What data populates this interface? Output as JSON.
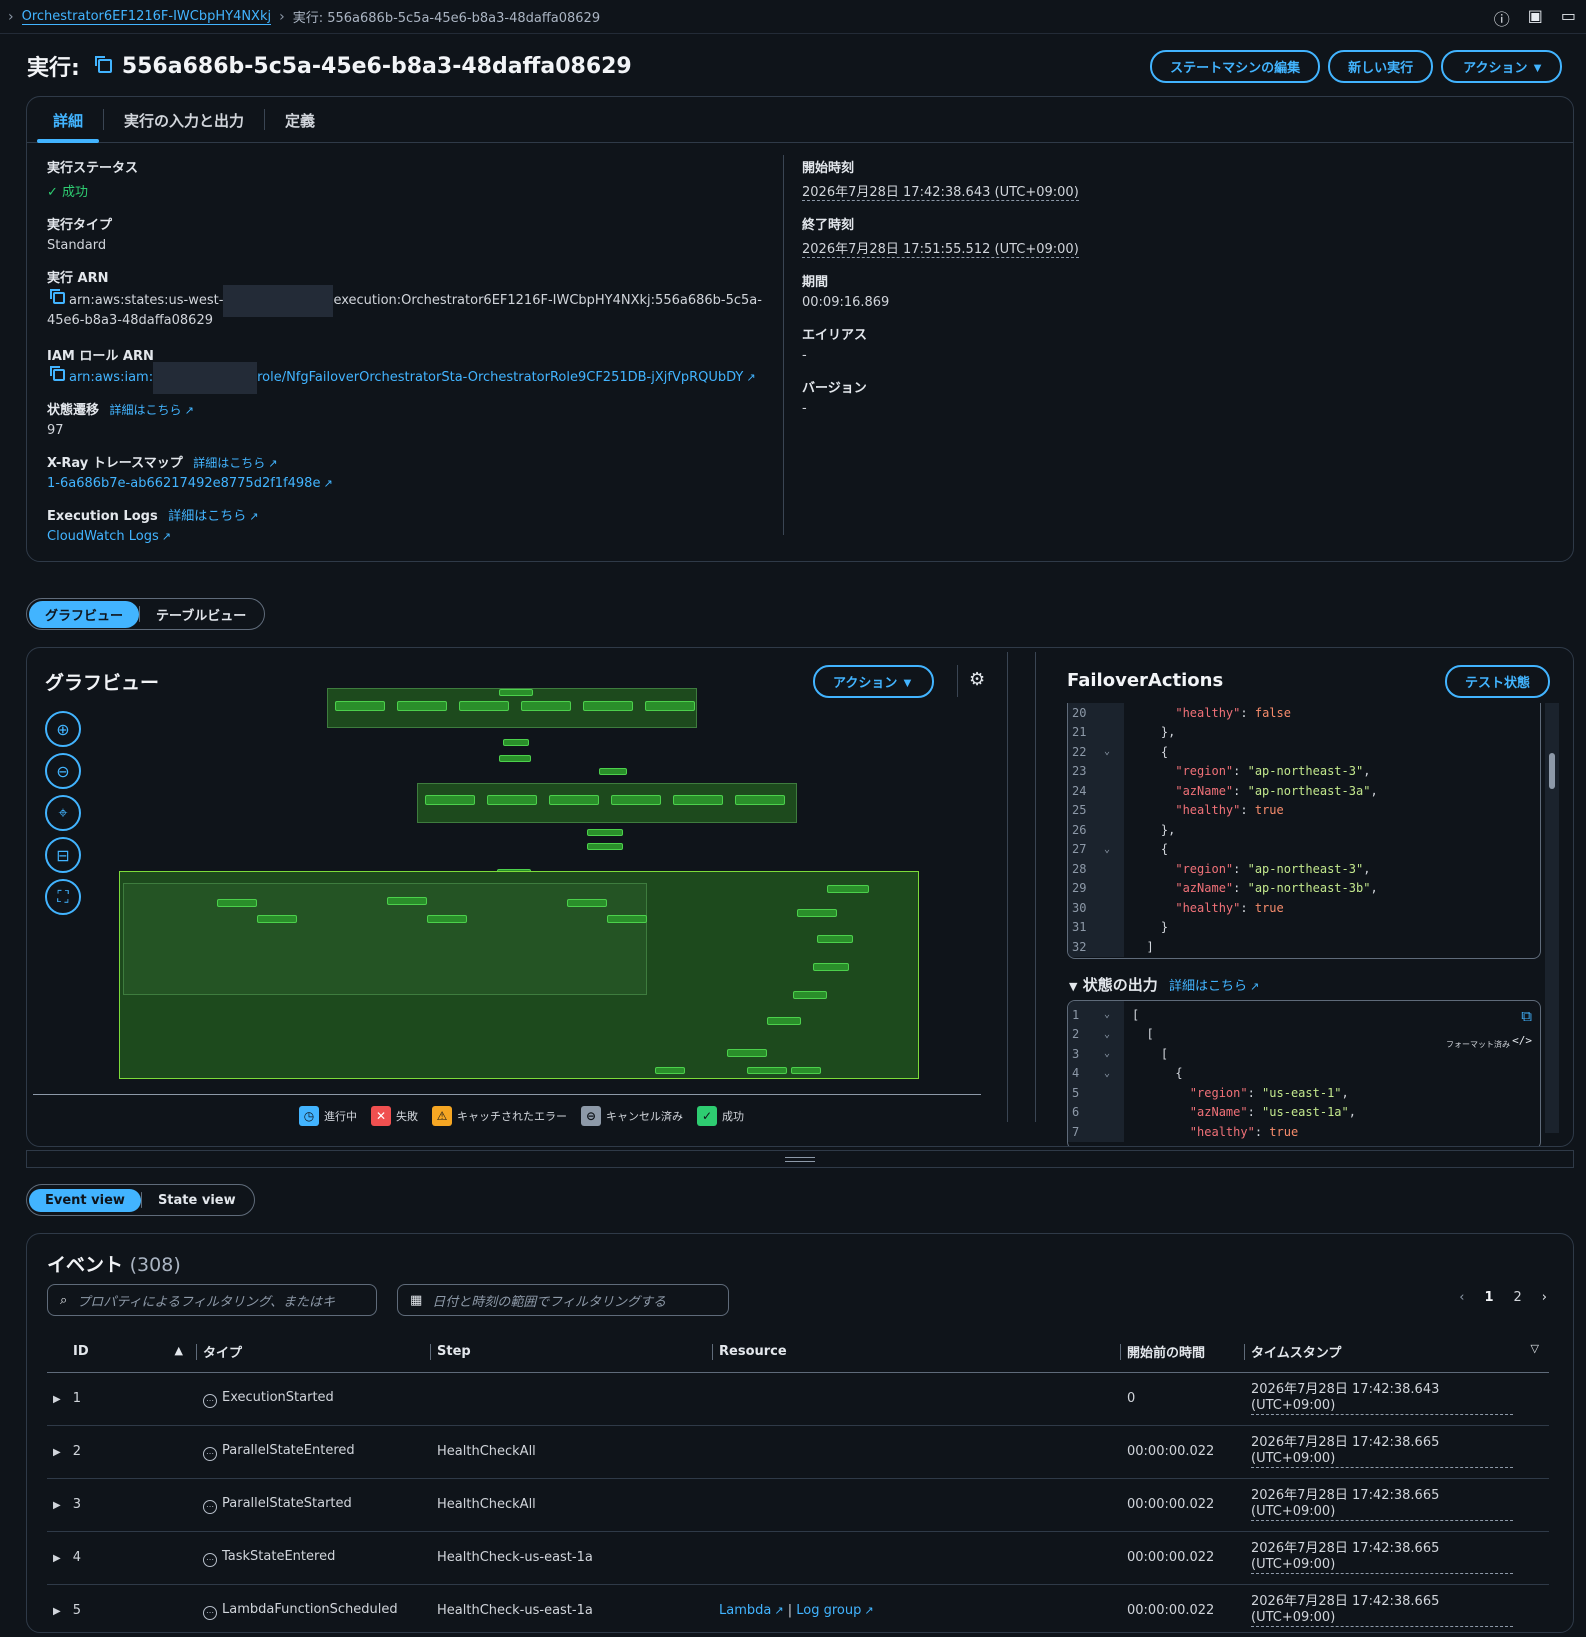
{
  "breadcrumb": {
    "parent": "Orchestrator6EF1216F-IWCbpHY4NXkj",
    "current": "実行: 556a686b-5c5a-45e6-b8a3-48daffa08629"
  },
  "header": {
    "title_prefix": "実行:",
    "execution_id": "556a686b-5c5a-45e6-b8a3-48daffa08629",
    "buttons": {
      "edit": "ステートマシンの編集",
      "new": "新しい実行",
      "actions": "アクション ▼"
    }
  },
  "details": {
    "tabs": [
      "詳細",
      "実行の入力と出力",
      "定義"
    ],
    "status_label": "実行ステータス",
    "status_value": "成功",
    "type_label": "実行タイプ",
    "type_value": "Standard",
    "arn_label": "実行 ARN",
    "arn_part1": "arn:aws:states:us-west-",
    "arn_part2": "execution:Orchestrator6EF1216F-IWCbpHY4NXkj:556a686b-5c5a-",
    "arn_part3": "45e6-b8a3-48daffa08629",
    "iam_label": "IAM ロール ARN",
    "iam_part1": "arn:aws:iam:",
    "iam_part2": "role/NfgFailoverOrchestratorSta-OrchestratorRole9CF251DB-jXjfVpRQUbDY",
    "transitions_label": "状態遷移",
    "learn_more": "詳細はこちら",
    "transitions_value": "97",
    "xray_label": "X-Ray トレースマップ",
    "xray_value": "1-6a686b7e-ab66217492e8775d2f1f498e",
    "logs_label": "Execution Logs",
    "logs_value": "CloudWatch Logs",
    "start_label": "開始時刻",
    "start_value": "2026年7月28日 17:42:38.643 (UTC+09:00)",
    "end_label": "終了時刻",
    "end_value": "2026年7月28日 17:51:55.512 (UTC+09:00)",
    "duration_label": "期間",
    "duration_value": "00:09:16.869",
    "alias_label": "エイリアス",
    "alias_value": "-",
    "version_label": "バージョン",
    "version_value": "-"
  },
  "view_toggle": {
    "graph": "グラフビュー",
    "table": "テーブルビュー"
  },
  "graph": {
    "title": "グラフビュー",
    "actions": "アクション ▼",
    "legend": {
      "in_progress": "進行中",
      "failed": "失敗",
      "caught": "キャッチされたエラー",
      "cancelled": "キャンセル済み",
      "succeeded": "成功"
    }
  },
  "state_panel": {
    "title": "FailoverActions",
    "test_button": "テスト状態",
    "output_label": "状態の出力",
    "formatted": "フォーマット済み",
    "input_lines": [
      {
        "n": "20",
        "f": "",
        "t": "      <span class=\"k\">\"healthy\"</span>: <span class=\"b\">false</span>"
      },
      {
        "n": "21",
        "f": "",
        "t": "    },"
      },
      {
        "n": "22",
        "f": "⌄",
        "t": "    {"
      },
      {
        "n": "23",
        "f": "",
        "t": "      <span class=\"k\">\"region\"</span>: <span class=\"s\">\"ap-northeast-3\"</span>,"
      },
      {
        "n": "24",
        "f": "",
        "t": "      <span class=\"k\">\"azName\"</span>: <span class=\"s\">\"ap-northeast-3a\"</span>,"
      },
      {
        "n": "25",
        "f": "",
        "t": "      <span class=\"k\">\"healthy\"</span>: <span class=\"b\">true</span>"
      },
      {
        "n": "26",
        "f": "",
        "t": "    },"
      },
      {
        "n": "27",
        "f": "⌄",
        "t": "    {"
      },
      {
        "n": "28",
        "f": "",
        "t": "      <span class=\"k\">\"region\"</span>: <span class=\"s\">\"ap-northeast-3\"</span>,"
      },
      {
        "n": "29",
        "f": "",
        "t": "      <span class=\"k\">\"azName\"</span>: <span class=\"s\">\"ap-northeast-3b\"</span>,"
      },
      {
        "n": "30",
        "f": "",
        "t": "      <span class=\"k\">\"healthy\"</span>: <span class=\"b\">true</span>"
      },
      {
        "n": "31",
        "f": "",
        "t": "    }"
      },
      {
        "n": "32",
        "f": "",
        "t": "  ]"
      }
    ],
    "output_lines": [
      {
        "n": "1",
        "f": "⌄",
        "t": "["
      },
      {
        "n": "2",
        "f": "⌄",
        "t": "  ["
      },
      {
        "n": "3",
        "f": "⌄",
        "t": "    ["
      },
      {
        "n": "4",
        "f": "⌄",
        "t": "      {"
      },
      {
        "n": "5",
        "f": "",
        "t": "        <span class=\"k\">\"region\"</span>: <span class=\"s\">\"us-east-1\"</span>,"
      },
      {
        "n": "6",
        "f": "",
        "t": "        <span class=\"k\">\"azName\"</span>: <span class=\"s\">\"us-east-1a\"</span>,"
      },
      {
        "n": "7",
        "f": "",
        "t": "        <span class=\"k\">\"healthy\"</span>: <span class=\"b\">true</span>"
      }
    ]
  },
  "events_toggle": {
    "event": "Event view",
    "state": "State view"
  },
  "events": {
    "title": "イベント",
    "count": "(308)",
    "search_placeholder": "プロパティによるフィルタリング、またはキ",
    "date_placeholder": "日付と時刻の範囲でフィルタリングする",
    "pages": [
      "1",
      "2"
    ],
    "columns": [
      "ID",
      "タイプ",
      "Step",
      "Resource",
      "開始前の時間",
      "タイムスタンプ"
    ],
    "rows": [
      {
        "id": "1",
        "type": "ExecutionStarted",
        "step": "",
        "resource": "",
        "elapsed": "0",
        "ts1": "2026年7月28日 17:42:38.643",
        "ts2": "(UTC+09:00)"
      },
      {
        "id": "2",
        "type": "ParallelStateEntered",
        "step": "HealthCheckAll",
        "resource": "",
        "elapsed": "00:00:00.022",
        "ts1": "2026年7月28日 17:42:38.665",
        "ts2": "(UTC+09:00)"
      },
      {
        "id": "3",
        "type": "ParallelStateStarted",
        "step": "HealthCheckAll",
        "resource": "",
        "elapsed": "00:00:00.022",
        "ts1": "2026年7月28日 17:42:38.665",
        "ts2": "(UTC+09:00)"
      },
      {
        "id": "4",
        "type": "TaskStateEntered",
        "step": "HealthCheck-us-east-1a",
        "resource": "",
        "elapsed": "00:00:00.022",
        "ts1": "2026年7月28日 17:42:38.665",
        "ts2": "(UTC+09:00)"
      },
      {
        "id": "5",
        "type": "LambdaFunctionScheduled",
        "step": "HealthCheck-us-east-1a",
        "resource": "Lambda",
        "resource2": "Log group",
        "elapsed": "00:00:00.022",
        "ts1": "2026年7月28日 17:42:38.665",
        "ts2": "(UTC+09:00)"
      }
    ]
  },
  "colors": {
    "accent": "#42b4ff",
    "success": "#2ecc71",
    "background": "#0f141a"
  }
}
